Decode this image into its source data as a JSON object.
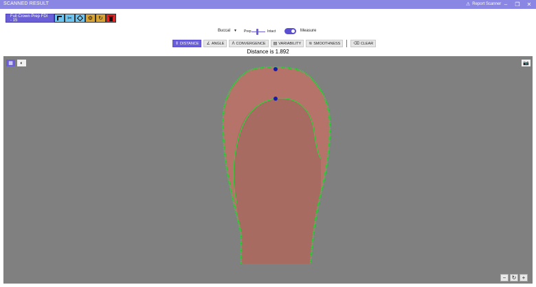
{
  "window": {
    "title": "SCANNED RESULT",
    "report_label": "Report Scanner"
  },
  "toolbar": {
    "tooth_label": "Full Crown Prep FDI - 15"
  },
  "controls": {
    "view_select": "Buccal",
    "prep_label": "Prep",
    "intact_label": "Intact",
    "slider_level": 0.45,
    "measure_label": "Measure",
    "measure_on": true
  },
  "tabs": {
    "distance": "DISTANCE",
    "angle": "ANGLE",
    "convergence": "CONVERGENCE",
    "variability": "VARIABILITY",
    "smoothness": "SMOOTHNESS",
    "clear": "CLEAR",
    "active": "distance"
  },
  "readout": {
    "distance_text": "Distance is 1.892"
  },
  "colors": {
    "accent": "#6a5fd6",
    "titlebar": "#8a86e3",
    "viewport_bg": "#808080",
    "tooth": "#b5736a",
    "margin_line": "#2fcf3a",
    "tool_blue": "#6ec6f0",
    "tool_gold": "#d9a431",
    "tool_red": "#e52222"
  },
  "icons": {
    "report": "warning-icon",
    "minimize": "minimize-icon",
    "maximize": "maximize-icon",
    "close": "close-icon"
  }
}
